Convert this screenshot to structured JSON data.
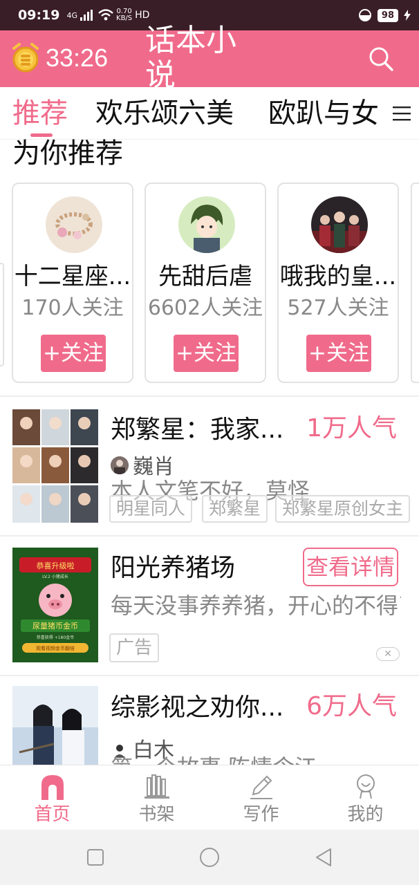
{
  "status_bar": {
    "time": "09:19",
    "signal": "4G",
    "net_speed_value": "0.70",
    "net_speed_unit": "KB/S",
    "hd": "HD",
    "battery": "98"
  },
  "header": {
    "timer": "33:26",
    "title": "话本小说",
    "accent_color": "#f06b8b"
  },
  "tabs": [
    {
      "label": "推荐",
      "active": true
    },
    {
      "label": "欢乐颂六美",
      "active": false
    },
    {
      "label": "欧趴与女",
      "active": false
    }
  ],
  "recommend": {
    "title": "为你推荐",
    "cards": [
      {
        "name": "十二星座...",
        "followers": "170人关注",
        "follow_label": "+关注"
      },
      {
        "name": "先甜后虐",
        "followers": "6602人关注",
        "follow_label": "+关注"
      },
      {
        "name": "哦我的皇...",
        "followers": "527人关注",
        "follow_label": "+关注"
      }
    ]
  },
  "feed": [
    {
      "title": "郑繁星：我家...",
      "popularity": "1万人气",
      "author": "巍肖",
      "description": "本人文笔不好，莫怪",
      "tags": [
        "明星同人",
        "郑繁星",
        "郑繁星原创女主"
      ]
    },
    {
      "title": "阳光养猪场",
      "button": "查看详情",
      "description": "每天没事养养猪，开心的不得了",
      "ad_tag": "广告",
      "ad_close": "✕",
      "cover": {
        "banner": "恭喜升级啦",
        "sub": "LV.2 小猪成长",
        "text": "尿量猪币金币",
        "small": "恭喜获得 +180金币",
        "btn": "观看视频金币翻倍"
      }
    },
    {
      "title": "综影视之劝你...",
      "popularity": "6万人气",
      "author": "白木",
      "description": "第一个故事 陈情令江"
    }
  ],
  "bottom_nav": [
    {
      "label": "首页",
      "icon": "home-icon",
      "active": true
    },
    {
      "label": "书架",
      "icon": "bookshelf-icon",
      "active": false
    },
    {
      "label": "写作",
      "icon": "pen-icon",
      "active": false
    },
    {
      "label": "我的",
      "icon": "profile-icon",
      "active": false
    }
  ]
}
